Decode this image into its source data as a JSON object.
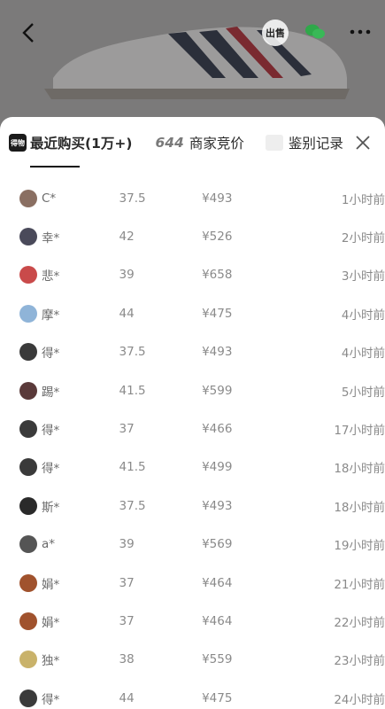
{
  "header": {
    "sell_badge": "出售",
    "icons": [
      "back-arrow-icon",
      "wechat-icon",
      "more-icon"
    ]
  },
  "tabs": {
    "recent_icon_text": "得物",
    "recent_label": "最近购买(1万+)",
    "bid_count": "644",
    "bid_label": "商家竞价",
    "auth_label": "鉴别记录"
  },
  "rows": [
    {
      "name": "C*",
      "size": "37.5",
      "price": "¥493",
      "time": "1小时前",
      "avatar_color": "#8a6f62"
    },
    {
      "name": "幸*",
      "size": "42",
      "price": "¥526",
      "time": "2小时前",
      "avatar_color": "#4a4a5a"
    },
    {
      "name": "悲*",
      "size": "39",
      "price": "¥658",
      "time": "3小时前",
      "avatar_color": "#c94a4a"
    },
    {
      "name": "摩*",
      "size": "44",
      "price": "¥475",
      "time": "4小时前",
      "avatar_color": "#8fb4d8"
    },
    {
      "name": "得*",
      "size": "37.5",
      "price": "¥493",
      "time": "4小时前",
      "avatar_color": "#3a3a3a"
    },
    {
      "name": "踢*",
      "size": "41.5",
      "price": "¥599",
      "time": "5小时前",
      "avatar_color": "#5a3a3a"
    },
    {
      "name": "得*",
      "size": "37",
      "price": "¥466",
      "time": "17小时前",
      "avatar_color": "#3a3a3a"
    },
    {
      "name": "得*",
      "size": "41.5",
      "price": "¥499",
      "time": "18小时前",
      "avatar_color": "#3a3a3a"
    },
    {
      "name": "斯*",
      "size": "37.5",
      "price": "¥493",
      "time": "18小时前",
      "avatar_color": "#2a2a2a"
    },
    {
      "name": "a*",
      "size": "39",
      "price": "¥569",
      "time": "19小时前",
      "avatar_color": "#555555"
    },
    {
      "name": "娟*",
      "size": "37",
      "price": "¥464",
      "time": "21小时前",
      "avatar_color": "#a0522d"
    },
    {
      "name": "娟*",
      "size": "37",
      "price": "¥464",
      "time": "22小时前",
      "avatar_color": "#a0522d"
    },
    {
      "name": "独*",
      "size": "38",
      "price": "¥559",
      "time": "23小时前",
      "avatar_color": "#c9b26a"
    },
    {
      "name": "得*",
      "size": "44",
      "price": "¥475",
      "time": "24小时前",
      "avatar_color": "#3a3a3a"
    }
  ]
}
